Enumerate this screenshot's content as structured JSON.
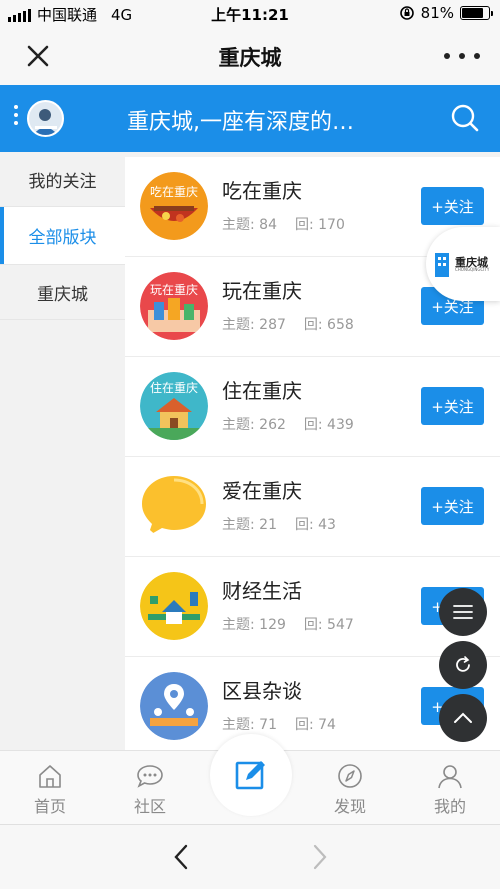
{
  "status_bar": {
    "carrier": "中国联通",
    "network": "4G",
    "time": "上午11:21",
    "battery": "81%",
    "battery_level": 0.81
  },
  "nav": {
    "title": "重庆城"
  },
  "header": {
    "headline": "重庆城,一座有深度的…"
  },
  "sidebar": {
    "items": [
      {
        "label": "我的关注",
        "active": false
      },
      {
        "label": "全部版块",
        "active": true
      },
      {
        "label": "重庆城",
        "active": false
      }
    ]
  },
  "forums": [
    {
      "name": "吃在重庆",
      "topics_label": "主题: 84",
      "replies_label": "回: 170",
      "follow_label": "+关注",
      "icon": "food-forum-icon"
    },
    {
      "name": "玩在重庆",
      "topics_label": "主题: 287",
      "replies_label": "回: 658",
      "follow_label": "+关注",
      "icon": "fun-forum-icon"
    },
    {
      "name": "住在重庆",
      "topics_label": "主题: 262",
      "replies_label": "回: 439",
      "follow_label": "+关注",
      "icon": "home-forum-icon"
    },
    {
      "name": "爱在重庆",
      "topics_label": "主题: 21",
      "replies_label": "回: 43",
      "follow_label": "+关注",
      "icon": "chat-bubble-icon"
    },
    {
      "name": "财经生活",
      "topics_label": "主题: 129",
      "replies_label": "回: 547",
      "follow_label": "+关注",
      "icon": "finance-forum-icon"
    },
    {
      "name": "区县杂谈",
      "topics_label": "主题: 71",
      "replies_label": "回: 74",
      "follow_label": "+关注",
      "icon": "district-forum-icon"
    }
  ],
  "float_badge": {
    "logo_text": "重庆城",
    "logo_sub": "CHONGQINGCITY"
  },
  "tabbar": {
    "tabs": [
      {
        "label": "首页",
        "icon": "home-icon"
      },
      {
        "label": "社区",
        "icon": "chat-icon"
      },
      {
        "label": "发现",
        "icon": "compass-icon"
      },
      {
        "label": "我的",
        "icon": "user-icon"
      }
    ]
  },
  "colors": {
    "accent": "#1b8ee8",
    "fab": "#2f3133"
  }
}
